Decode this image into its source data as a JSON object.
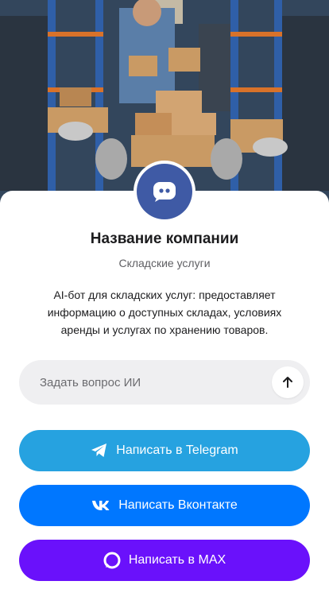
{
  "company": {
    "name": "Название компании",
    "category": "Складские услуги",
    "description": "AI-бот для складских услуг: предоставляет информацию о доступных складах, условиях аренды и услугах по хранению товаров."
  },
  "ask": {
    "placeholder": "Задать вопрос ИИ",
    "send_icon": "arrow-up-icon"
  },
  "buttons": {
    "telegram": {
      "label": "Написать в Telegram",
      "icon": "telegram-icon",
      "color": "#26a2e0"
    },
    "vk": {
      "label": "Написать Вконтакте",
      "icon": "vk-icon",
      "color": "#0077ff"
    },
    "max": {
      "label": "Написать в MAX",
      "icon": "max-icon",
      "color": "#6a11fb"
    }
  },
  "colors": {
    "avatar": "#3f5aa5"
  }
}
